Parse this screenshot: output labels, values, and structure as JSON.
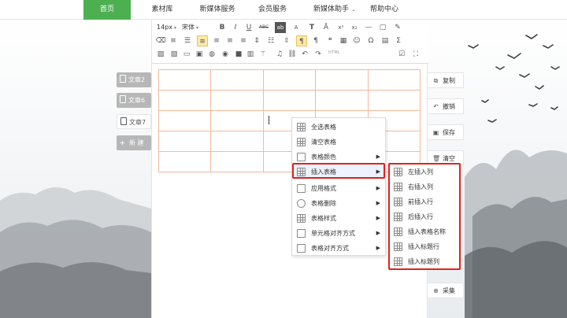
{
  "nav": {
    "tabs": [
      {
        "label": "首页",
        "active": true
      },
      {
        "label": "素材库"
      },
      {
        "label": "新媒体服务"
      },
      {
        "label": "会员服务"
      },
      {
        "label": "新媒体助手"
      },
      {
        "label": "帮助中心"
      }
    ],
    "caret": "⌄",
    "active_color": "#4cb050"
  },
  "articles": [
    {
      "label": "文章2"
    },
    {
      "label": "文章6"
    },
    {
      "label": "文章7"
    },
    {
      "label": "新 建"
    }
  ],
  "toolbar": {
    "font_size": "14px",
    "font_family": "宋体",
    "bold": "B",
    "italic": "I",
    "underline": "U",
    "strike": "ABC",
    "html_label": "HTML",
    "caret": "▾"
  },
  "side_buttons": [
    {
      "label": "复制",
      "icon": "⧉"
    },
    {
      "label": "撤销",
      "icon": "↶"
    },
    {
      "label": "保存",
      "icon": "▣"
    },
    {
      "label": "清空",
      "icon": "🗑"
    },
    {
      "label": "采集",
      "icon": "⊕"
    }
  ],
  "context_menu": {
    "items": [
      {
        "label": "全选表格",
        "icon": "table-icon"
      },
      {
        "label": "清空表格",
        "icon": "table-clear-icon"
      },
      {
        "label": "表格颜色",
        "icon": "color-icon",
        "has_submenu": true
      },
      {
        "label": "插入表格",
        "icon": "table-insert-icon",
        "has_submenu": true,
        "highlighted": true
      },
      {
        "label": "应用格式",
        "icon": "format-icon",
        "has_submenu": true
      },
      {
        "label": "表格删除",
        "icon": "delete-icon",
        "has_submenu": true
      },
      {
        "label": "表格样式",
        "icon": "style-icon",
        "has_submenu": true
      },
      {
        "label": "单元格对齐方式",
        "icon": "cell-align-icon",
        "has_submenu": true
      },
      {
        "label": "表格对齐方式",
        "icon": "table-align-icon",
        "has_submenu": true
      }
    ],
    "arrow": "▶",
    "highlight_color": "#e0221d"
  },
  "submenu": {
    "items": [
      {
        "label": "左插入列"
      },
      {
        "label": "右插入列"
      },
      {
        "label": "前插入行"
      },
      {
        "label": "后插入行"
      },
      {
        "label": "插入表格名称"
      },
      {
        "label": "插入标题行"
      },
      {
        "label": "插入标题列"
      }
    ]
  }
}
